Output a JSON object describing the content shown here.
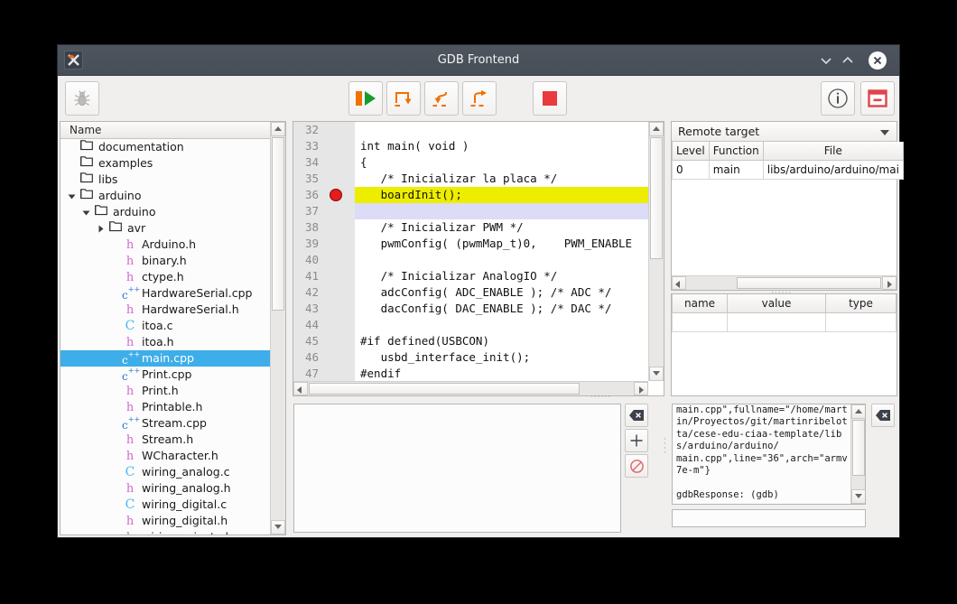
{
  "window": {
    "title": "GDB Frontend",
    "app_icon": "x-logo-icon",
    "minimize_label": "chevron-down-icon",
    "maximize_label": "chevron-up-icon",
    "close_label": "close-icon"
  },
  "toolbar": {
    "buttons": [
      {
        "name": "debug-bug-button",
        "icon": "bug-icon",
        "enabled": false
      },
      {
        "name": "continue-button",
        "icon": "continue-icon"
      },
      {
        "name": "step-over-button",
        "icon": "step-over-icon"
      },
      {
        "name": "step-into-button",
        "icon": "step-into-icon"
      },
      {
        "name": "step-out-button",
        "icon": "step-out-icon"
      },
      {
        "name": "stop-button",
        "icon": "stop-square-icon"
      },
      {
        "name": "info-button",
        "icon": "info-circle-icon"
      },
      {
        "name": "panel-toggle-button",
        "icon": "window-minus-icon"
      }
    ],
    "accent_orange": "#f07000",
    "accent_green": "#179c2c",
    "accent_red": "#e83a3f"
  },
  "tree": {
    "header": "Name",
    "items": [
      {
        "label": "documentation",
        "indent": 0,
        "type": "folder",
        "arrow": "none"
      },
      {
        "label": "examples",
        "indent": 0,
        "type": "folder",
        "arrow": "none"
      },
      {
        "label": "libs",
        "indent": 0,
        "type": "folder",
        "arrow": "none"
      },
      {
        "label": "arduino",
        "indent": 0,
        "type": "folder",
        "arrow": "open"
      },
      {
        "label": "arduino",
        "indent": 1,
        "type": "folder",
        "arrow": "open"
      },
      {
        "label": "avr",
        "indent": 2,
        "type": "folder",
        "arrow": "closed"
      },
      {
        "label": "Arduino.h",
        "indent": 3,
        "type": "h",
        "arrow": "none"
      },
      {
        "label": "binary.h",
        "indent": 3,
        "type": "h",
        "arrow": "none"
      },
      {
        "label": "ctype.h",
        "indent": 3,
        "type": "h",
        "arrow": "none"
      },
      {
        "label": "HardwareSerial.cpp",
        "indent": 3,
        "type": "cpp",
        "arrow": "none"
      },
      {
        "label": "HardwareSerial.h",
        "indent": 3,
        "type": "h",
        "arrow": "none"
      },
      {
        "label": "itoa.c",
        "indent": 3,
        "type": "c",
        "arrow": "none"
      },
      {
        "label": "itoa.h",
        "indent": 3,
        "type": "h",
        "arrow": "none"
      },
      {
        "label": "main.cpp",
        "indent": 3,
        "type": "cpp",
        "arrow": "none",
        "selected": true
      },
      {
        "label": "Print.cpp",
        "indent": 3,
        "type": "cpp",
        "arrow": "none"
      },
      {
        "label": "Print.h",
        "indent": 3,
        "type": "h",
        "arrow": "none"
      },
      {
        "label": "Printable.h",
        "indent": 3,
        "type": "h",
        "arrow": "none"
      },
      {
        "label": "Stream.cpp",
        "indent": 3,
        "type": "cpp",
        "arrow": "none"
      },
      {
        "label": "Stream.h",
        "indent": 3,
        "type": "h",
        "arrow": "none"
      },
      {
        "label": "WCharacter.h",
        "indent": 3,
        "type": "h",
        "arrow": "none"
      },
      {
        "label": "wiring_analog.c",
        "indent": 3,
        "type": "c",
        "arrow": "none"
      },
      {
        "label": "wiring_analog.h",
        "indent": 3,
        "type": "h",
        "arrow": "none"
      },
      {
        "label": "wiring_digital.c",
        "indent": 3,
        "type": "c",
        "arrow": "none"
      },
      {
        "label": "wiring_digital.h",
        "indent": 3,
        "type": "h",
        "arrow": "none"
      },
      {
        "label": "wiring_private.h",
        "indent": 3,
        "type": "h",
        "arrow": "none"
      }
    ],
    "selection_color": "#3daee9"
  },
  "editor": {
    "lines": [
      {
        "n": "32",
        "text": "",
        "bp": false,
        "hl": "none"
      },
      {
        "n": "33",
        "text": "int main( void )",
        "bp": false,
        "hl": "none"
      },
      {
        "n": "34",
        "text": "{",
        "bp": false,
        "hl": "none"
      },
      {
        "n": "35",
        "text": "   /* Inicializar la placa */",
        "bp": false,
        "hl": "none"
      },
      {
        "n": "36",
        "text": "   boardInit();",
        "bp": true,
        "hl": "exec"
      },
      {
        "n": "37",
        "text": "",
        "bp": false,
        "hl": "cursor"
      },
      {
        "n": "38",
        "text": "   /* Inicializar PWM */",
        "bp": false,
        "hl": "none"
      },
      {
        "n": "39",
        "text": "   pwmConfig( (pwmMap_t)0,    PWM_ENABLE",
        "bp": false,
        "hl": "none"
      },
      {
        "n": "40",
        "text": "",
        "bp": false,
        "hl": "none"
      },
      {
        "n": "41",
        "text": "   /* Inicializar AnalogIO */",
        "bp": false,
        "hl": "none"
      },
      {
        "n": "42",
        "text": "   adcConfig( ADC_ENABLE ); /* ADC */",
        "bp": false,
        "hl": "none"
      },
      {
        "n": "43",
        "text": "   dacConfig( DAC_ENABLE ); /* DAC */",
        "bp": false,
        "hl": "none"
      },
      {
        "n": "44",
        "text": "",
        "bp": false,
        "hl": "none"
      },
      {
        "n": "45",
        "text": "#if defined(USBCON)",
        "bp": false,
        "hl": "none"
      },
      {
        "n": "46",
        "text": "   usbd_interface_init();",
        "bp": false,
        "hl": "none"
      },
      {
        "n": "47",
        "text": "#endif",
        "bp": false,
        "hl": "none"
      }
    ],
    "exec_line_color": "#eded00",
    "cursor_line_color": "#dcdcf7",
    "breakpoint_color": "#e81b1b"
  },
  "stack": {
    "target_label": "Remote target",
    "columns": [
      "Level",
      "Function",
      "File"
    ],
    "rows": [
      {
        "level": "0",
        "function": "main",
        "file": "libs/arduino/arduino/mai"
      }
    ]
  },
  "variables": {
    "columns": [
      "name",
      "value",
      "type"
    ],
    "rows": [
      {
        "name": "",
        "value": "",
        "type": ""
      }
    ]
  },
  "breakpoints_panel": {
    "buttons": [
      {
        "name": "clear-breakpoints-button",
        "icon": "backspace-delete-icon"
      },
      {
        "name": "add-breakpoint-button",
        "icon": "plus-icon"
      },
      {
        "name": "disable-breakpoint-button",
        "icon": "no-entry-icon"
      }
    ]
  },
  "console": {
    "output": "main.cpp\",fullname=\"/home/martin/Proyectos/git/martinribelotta/cese-edu-ciaa-template/libs/arduino/arduino/\nmain.cpp\",line=\"36\",arch=\"armv7e-m\"}\n\ngdbResponse: (gdb)",
    "input_value": "",
    "input_placeholder": "",
    "clear_button": {
      "name": "clear-console-button",
      "icon": "backspace-delete-icon"
    }
  }
}
